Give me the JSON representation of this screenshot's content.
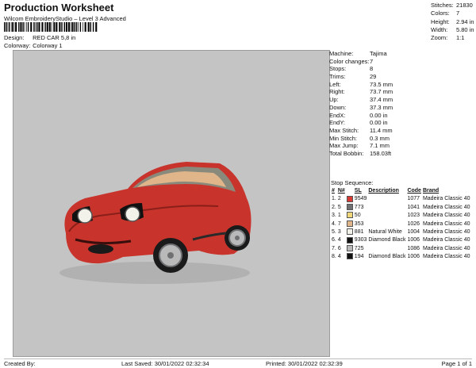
{
  "header": {
    "title": "Production Worksheet",
    "subtitle": "Wilcom EmbroideryStudio – Level 3 Advanced",
    "design_label": "Design:",
    "design_value": "RED CAR 5,8 in",
    "colorway_label": "Colorway:",
    "colorway_value": "Colorway 1"
  },
  "summary": [
    {
      "label": "Stitches:",
      "value": "21830"
    },
    {
      "label": "Colors:",
      "value": "7"
    },
    {
      "label": "Height:",
      "value": "2.94 in"
    },
    {
      "label": "Width:",
      "value": "5.80 in"
    },
    {
      "label": "Zoom:",
      "value": "1:1"
    }
  ],
  "machine": [
    {
      "label": "Machine:",
      "value": "Tajima"
    },
    {
      "label": "Color changes:",
      "value": "7"
    },
    {
      "label": "Stops:",
      "value": "8"
    },
    {
      "label": "Trims:",
      "value": "29"
    },
    {
      "label": "Left:",
      "value": "73.5 mm"
    },
    {
      "label": "Right:",
      "value": "73.7 mm"
    },
    {
      "label": "Up:",
      "value": "37.4 mm"
    },
    {
      "label": "Down:",
      "value": "37.3 mm"
    },
    {
      "label": "EndX:",
      "value": "0.00 in"
    },
    {
      "label": "EndY:",
      "value": "0.00 in"
    },
    {
      "label": "Max Stitch:",
      "value": "11.4 mm"
    },
    {
      "label": "Min Stitch:",
      "value": "0.3 mm"
    },
    {
      "label": "Max Jump:",
      "value": "7.1 mm"
    },
    {
      "label": "Total Bobbin:",
      "value": "158.03ft"
    }
  ],
  "stop_sequence": {
    "title": "Stop Sequence:",
    "headers": [
      "#",
      "N#",
      "SL",
      "Description",
      "Code",
      "Brand"
    ],
    "rows": [
      {
        "stop": "1.",
        "n": "2",
        "color": "#d83a33",
        "sl": "9549",
        "desc": "",
        "code": "1077",
        "brand": "Madeira Classic 40"
      },
      {
        "stop": "2.",
        "n": "5",
        "color": "#6f7072",
        "sl": "773",
        "desc": "",
        "code": "1041",
        "brand": "Madeira Classic 40"
      },
      {
        "stop": "3.",
        "n": "1",
        "color": "#f0d87a",
        "sl": "50",
        "desc": "",
        "code": "1023",
        "brand": "Madeira Classic 40"
      },
      {
        "stop": "4.",
        "n": "7",
        "color": "#e0b58a",
        "sl": "353",
        "desc": "",
        "code": "1026",
        "brand": "Madeira Classic 40"
      },
      {
        "stop": "5.",
        "n": "3",
        "color": "#f2f2ea",
        "sl": "881",
        "desc": "Natural White",
        "code": "1004",
        "brand": "Madeira Classic 40"
      },
      {
        "stop": "6.",
        "n": "4",
        "color": "#111111",
        "sl": "9303",
        "desc": "Diamond Black",
        "code": "1006",
        "brand": "Madeira Classic 40"
      },
      {
        "stop": "7.",
        "n": "6",
        "color": "#b9b9b9",
        "sl": "725",
        "desc": "",
        "code": "1086",
        "brand": "Madeira Classic 40"
      },
      {
        "stop": "8.",
        "n": "4",
        "color": "#111111",
        "sl": "194",
        "desc": "Diamond Black",
        "code": "1006",
        "brand": "Madeira Classic 40"
      }
    ]
  },
  "footer": {
    "created": "Created By:",
    "saved": "Last Saved: 30/01/2022 02:32:34",
    "printed": "Printed: 30/01/2022 02:32:39",
    "page": "Page 1 of 1"
  }
}
